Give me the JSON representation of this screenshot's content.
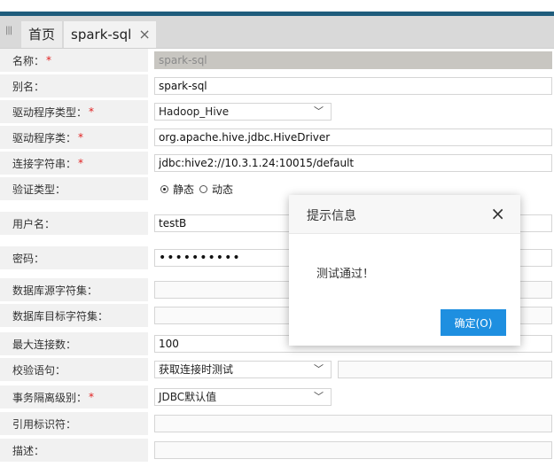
{
  "tabs": [
    {
      "label": "首页"
    },
    {
      "label": "spark-sql",
      "close": "×"
    }
  ],
  "form": {
    "name": {
      "label": "名称：",
      "required": "*",
      "value": "spark-sql"
    },
    "alias": {
      "label": "别名：",
      "value": "spark-sql"
    },
    "driver_type": {
      "label": "驱动程序类型：",
      "required": "*",
      "value": "Hadoop_Hive"
    },
    "driver_class": {
      "label": "驱动程序类：",
      "required": "*",
      "value": "org.apache.hive.jdbc.HiveDriver"
    },
    "conn_string": {
      "label": "连接字符串：",
      "required": "*",
      "value": "jdbc:hive2://10.3.1.24:10015/default"
    },
    "auth_type": {
      "label": "验证类型：",
      "options": [
        "静态",
        "动态"
      ],
      "selected": "静态"
    },
    "username": {
      "label": "用户名：",
      "value": "testB"
    },
    "password": {
      "label": "密码：",
      "value": "••••••••••"
    },
    "src_charset": {
      "label": "数据库源字符集：",
      "value": ""
    },
    "dst_charset": {
      "label": "数据库目标字符集：",
      "value": ""
    },
    "max_conn": {
      "label": "最大连接数：",
      "value": "100"
    },
    "validation": {
      "label": "校验语句：",
      "value": "获取连接时测试"
    },
    "isolation": {
      "label": "事务隔离级别：",
      "required": "*",
      "value": "JDBC默认值"
    },
    "quote_char": {
      "label": "引用标识符：",
      "value": ""
    },
    "description": {
      "label": "描述：",
      "value": ""
    }
  },
  "dialog": {
    "title": "提示信息",
    "close": "×",
    "message": "测试通过！",
    "ok_label": "确定(O)"
  },
  "colors": {
    "accent_bar": "#1f5d7c",
    "ok_button": "#1e8fe0",
    "required": "#e02020"
  }
}
